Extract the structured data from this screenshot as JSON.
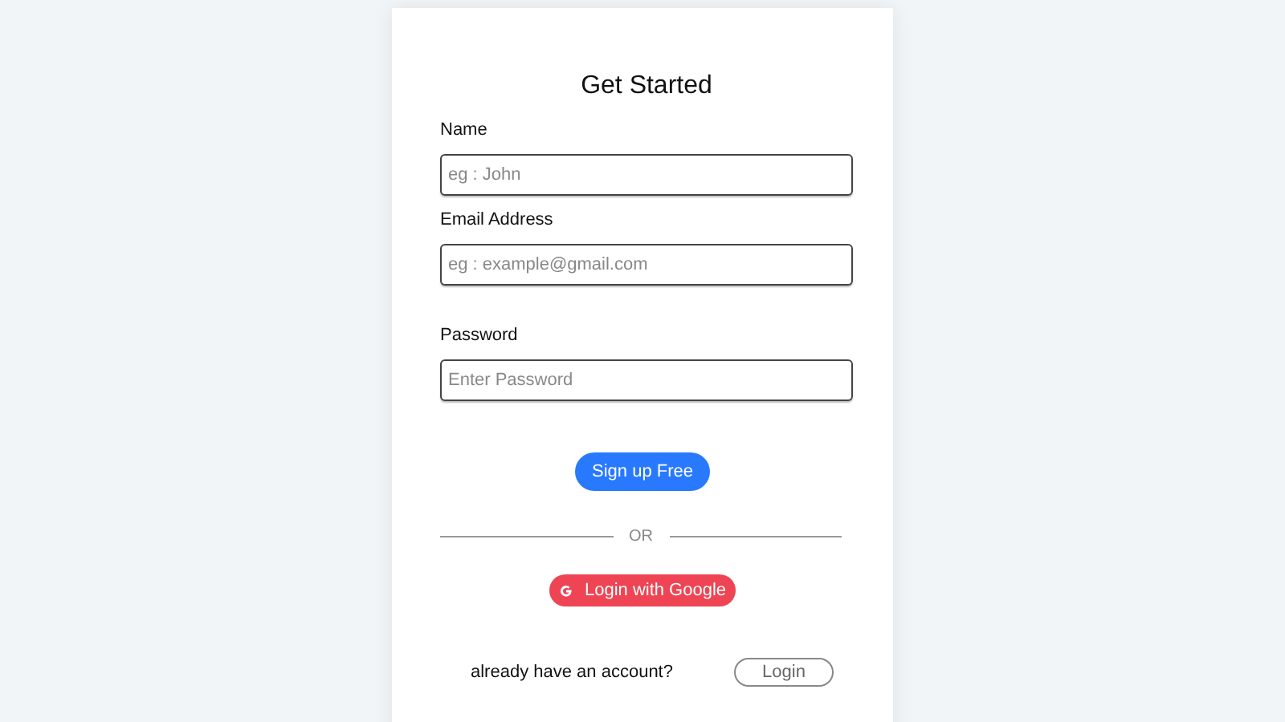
{
  "title": "Get Started",
  "fields": [
    {
      "label": "Name",
      "placeholder": "eg : John"
    },
    {
      "label": "Email Address",
      "placeholder": "eg : example@gmail.com"
    },
    {
      "label": "Password",
      "placeholder": "Enter Password"
    }
  ],
  "signup_button": "Sign up Free",
  "divider": "OR",
  "google_button": "Login with Google",
  "footer": {
    "text": "already have an account?",
    "login_button": "Login"
  }
}
